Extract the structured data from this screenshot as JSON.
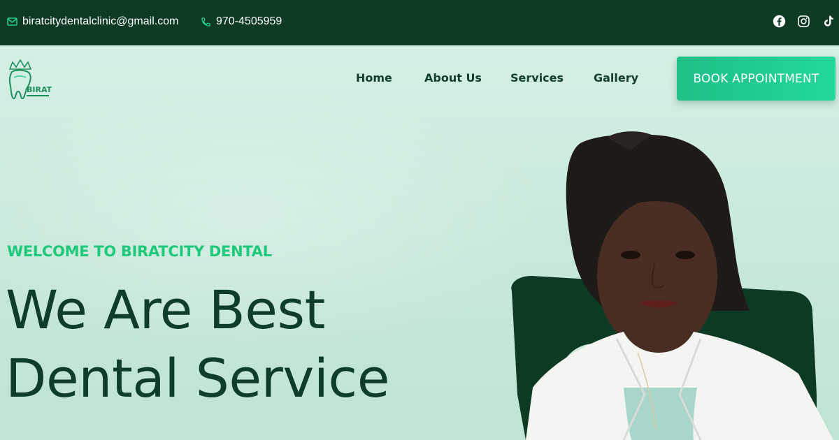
{
  "topbar": {
    "email": "biratcitydentalclinic@gmail.com",
    "phone": "970-4505959",
    "social_icons": [
      "facebook-icon",
      "instagram-icon",
      "tiktok-icon"
    ]
  },
  "logo": {
    "text": "BIRAT"
  },
  "nav": {
    "items": [
      "Home",
      "About Us",
      "Services",
      "Gallery"
    ],
    "cta": "BOOK APPOINTMENT"
  },
  "hero": {
    "eyebrow": "WELCOME TO BIRATCITY DENTAL",
    "headline_line1": "We Are Best",
    "headline_line2": "Dental Service"
  },
  "colors": {
    "topbar": "#0c3a23",
    "accent": "#1fc97c",
    "button": "#22d89a",
    "heading": "#0e3e27",
    "hero_bg": "#cfeadf"
  }
}
